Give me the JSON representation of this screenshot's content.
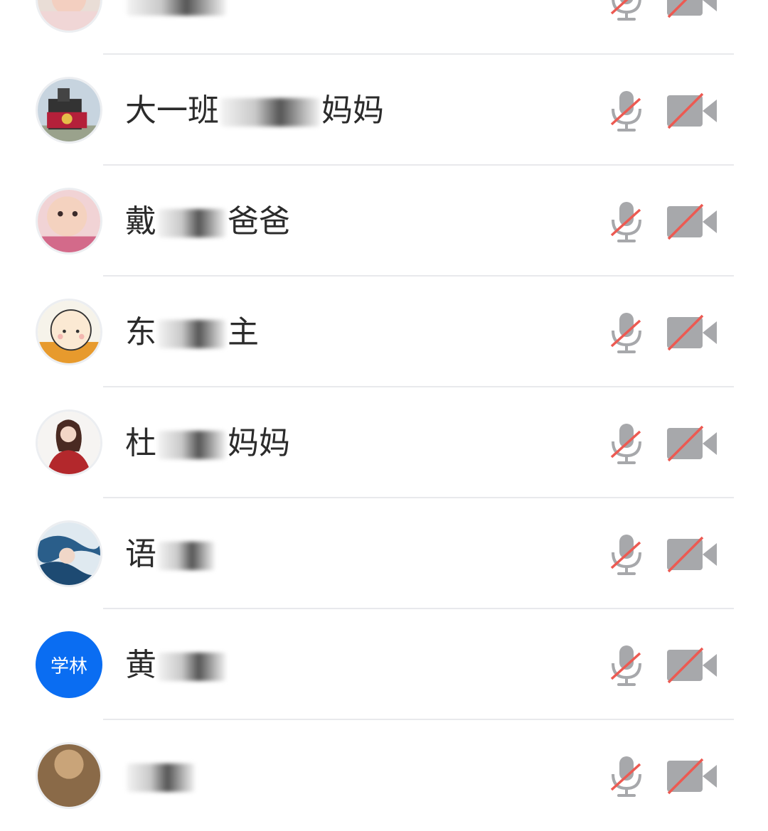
{
  "participants": [
    {
      "name_visible": "",
      "avatar": "child-photo-avatar"
    },
    {
      "name_visible": "大一班",
      "name_suffix": "妈妈",
      "avatar": "train-photo-avatar"
    },
    {
      "name_visible": "戴",
      "name_suffix": "爸爸",
      "avatar": "baby-photo-avatar"
    },
    {
      "name_visible": "东",
      "name_suffix": "主",
      "avatar": "cartoon-monk-avatar"
    },
    {
      "name_visible": "杜",
      "name_suffix": "妈妈",
      "avatar": "woman-portrait-avatar"
    },
    {
      "name_visible": "语",
      "name_suffix": "",
      "avatar": "blue-pattern-avatar"
    },
    {
      "name_visible": "黄",
      "name_suffix": "",
      "avatar_initials": "学林"
    },
    {
      "name_visible": "",
      "avatar": "brown-photo-avatar"
    }
  ],
  "icons": {
    "mic": "mic-muted-icon",
    "camera": "camera-off-icon"
  },
  "colors": {
    "icon_gray": "#a7a8ab",
    "mute_red": "#ec5a52",
    "initials_avatar_bg": "#0a6df2",
    "divider": "#e8e9ec"
  }
}
